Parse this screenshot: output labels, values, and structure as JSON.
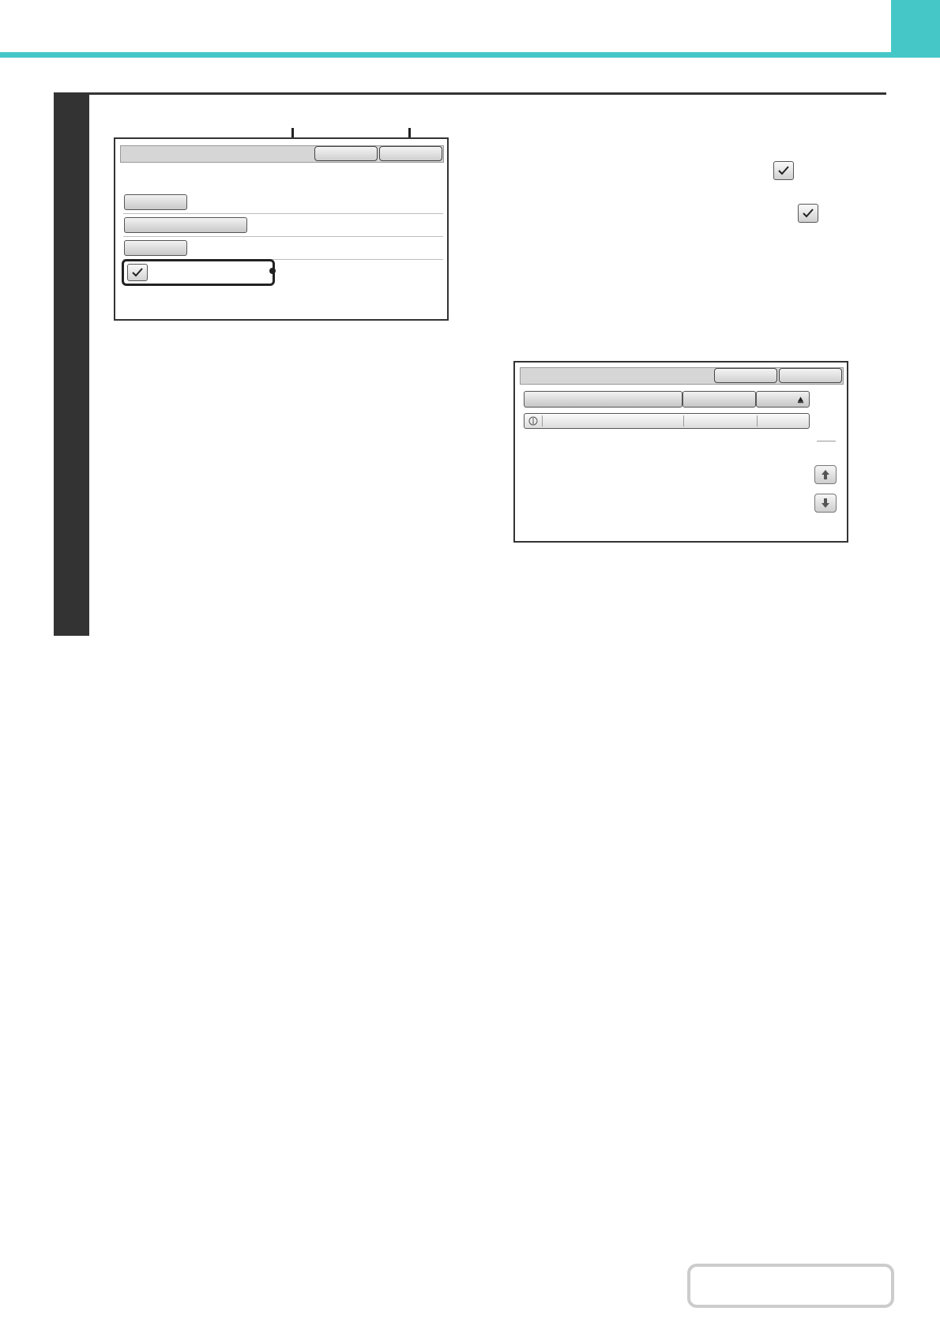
{
  "page": {
    "accent_color": "#46c7c7",
    "step_bar_color": "#333333"
  },
  "figure1": {
    "checkbox_state": "checked",
    "checkbox_icon": "checkmark-icon"
  },
  "instructions": {
    "inline_icons": [
      "checkmark-icon",
      "checkmark-icon"
    ]
  },
  "figure2": {
    "sort_indicator_icon": "triangle-up-icon",
    "row_icon": "document-icon",
    "scroll_up_icon": "arrow-up-icon",
    "scroll_down_icon": "arrow-down-icon"
  }
}
